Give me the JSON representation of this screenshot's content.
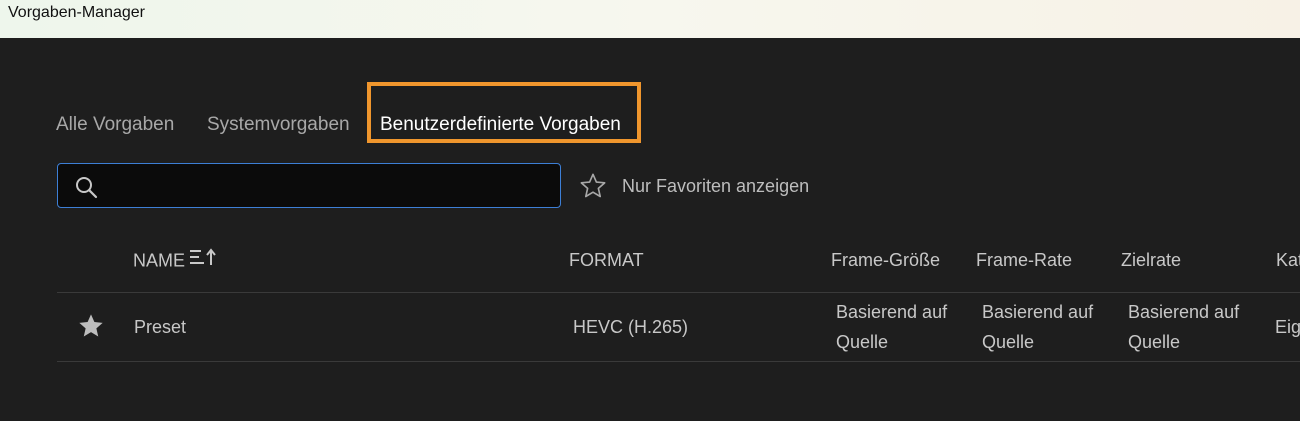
{
  "window": {
    "title": "Vorgaben-Manager"
  },
  "tabs": [
    {
      "label": "Alle Vorgaben",
      "active": false
    },
    {
      "label": "Systemvorgaben",
      "active": false
    },
    {
      "label": "Benutzerdefinierte Vorgaben",
      "active": true
    }
  ],
  "highlight_color": "#f0962d",
  "search": {
    "icon": "search-icon",
    "value": "",
    "placeholder": "",
    "border_color": "#3d7fd6"
  },
  "favorites_toggle": {
    "icon": "star-outline-icon",
    "label": "Nur Favoriten anzeigen"
  },
  "table": {
    "columns": [
      {
        "label": "NAME",
        "sort_icon": "sort-ascending-icon"
      },
      {
        "label": "FORMAT"
      },
      {
        "label": "Frame-Größe"
      },
      {
        "label": "Frame-Rate"
      },
      {
        "label": "Zielrate"
      },
      {
        "label": "Kat"
      }
    ],
    "rows": [
      {
        "favorite_icon": "star-filled-icon",
        "name": "Preset",
        "format": "HEVC (H.265)",
        "frame_size": "Basierend auf Quelle",
        "frame_rate": "Basierend auf Quelle",
        "target_rate": "Basierend auf Quelle",
        "category": "Eige"
      }
    ]
  }
}
